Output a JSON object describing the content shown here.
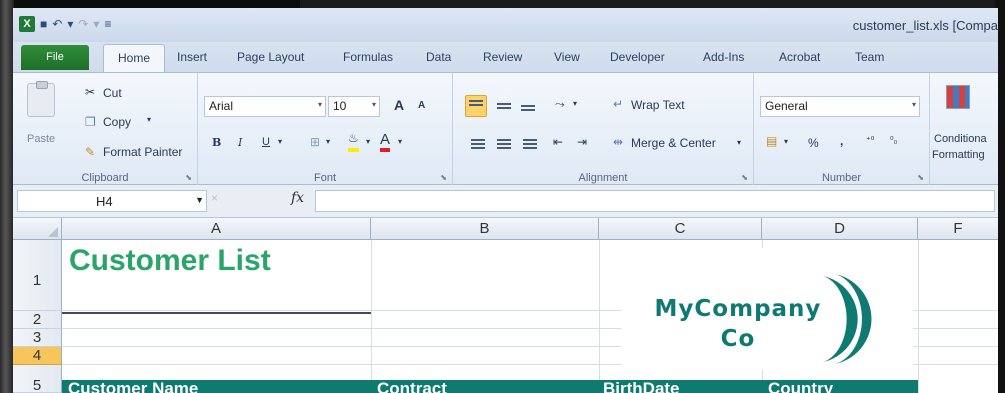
{
  "window": {
    "title": "customer_list.xls  [Compa"
  },
  "quick_access": {
    "excel_logo": "X"
  },
  "tabs": [
    "File",
    "Home",
    "Insert",
    "Page Layout",
    "Formulas",
    "Data",
    "Review",
    "View",
    "Developer",
    "Add-Ins",
    "Acrobat",
    "Team"
  ],
  "clipboard": {
    "cut": "Cut",
    "copy": "Copy",
    "format_painter": "Format Painter",
    "paste": "Paste",
    "label": "Clipboard"
  },
  "font": {
    "name": "Arial",
    "size": "10",
    "bold": "B",
    "italic": "I",
    "underline": "U",
    "grow": "A",
    "shrink": "A",
    "color_a": "A",
    "label": "Font"
  },
  "alignment": {
    "wrap_text": "Wrap Text",
    "merge_center": "Merge & Center",
    "label": "Alignment"
  },
  "number": {
    "format": "General",
    "percent": "%",
    "comma": ",",
    "label": "Number"
  },
  "styles": {
    "conditional": "Conditiona",
    "formatting": "Formatting"
  },
  "formula_bar": {
    "name_box": "H4",
    "fx": "fx",
    "cancel": "×",
    "value": ""
  },
  "columns": [
    "A",
    "B",
    "C",
    "D",
    "F"
  ],
  "rows": [
    "1",
    "2",
    "3",
    "4",
    "5"
  ],
  "sheet": {
    "title": "Customer List",
    "logo_line1": "MyCompany",
    "logo_line2": "Co",
    "headers": [
      "Customer Name",
      "Contract",
      "BirthDate",
      "Country"
    ]
  },
  "colors": {
    "accent": "#2aa56a",
    "header_fill": "#0f7a70",
    "selected_row": "#f7c65a"
  }
}
